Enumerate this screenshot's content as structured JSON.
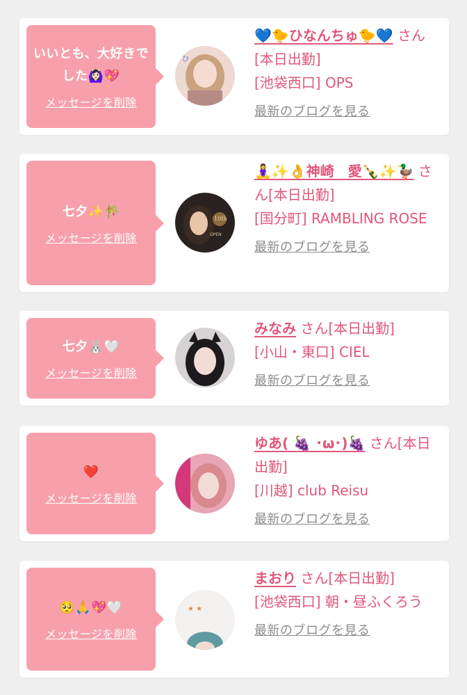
{
  "entries": [
    {
      "message": "いいとも、大好きでした🙆🏻‍♀️💖",
      "delete_label": "メッセージを削除",
      "name": "💙🐤ひなんちゅ🐤💙",
      "suffix": " さん[本日出勤]",
      "shop": "[池袋西口] OPS",
      "blog_label": "最新のブログを見る"
    },
    {
      "message": "七夕✨🎋",
      "delete_label": "メッセージを削除",
      "name": "🧘‍♀️✨👌神崎　愛🍾✨🦆",
      "suffix": " さん[本日出勤]",
      "shop": "[国分町] RAMBLING ROSE",
      "blog_label": "最新のブログを見る"
    },
    {
      "message": "七夕🐰🤍",
      "delete_label": "メッセージを削除",
      "name": "みなみ",
      "suffix": " さん[本日出勤]",
      "shop": "[小山・東口] CIEL",
      "blog_label": "最新のブログを見る"
    },
    {
      "message": "❤️",
      "delete_label": "メッセージを削除",
      "name": "ゆあ( 🍇 ･ω･)🍇",
      "suffix": " さん[本日出勤]",
      "shop": "[川越] club Reisu",
      "blog_label": "最新のブログを見る"
    },
    {
      "message": "🥺🙏💖🤍",
      "delete_label": "メッセージを削除",
      "name": "まおり",
      "suffix": " さん[本日出勤]",
      "shop": "[池袋西口] 朝・昼ふくろう",
      "blog_label": "最新のブログを見る"
    }
  ],
  "colors": {
    "background": "#efefef",
    "bubble": "#f7a0ac",
    "accent_pink": "#e0577a",
    "link_gray": "#8c8c8c"
  },
  "icons": [
    "avatar-photo"
  ]
}
